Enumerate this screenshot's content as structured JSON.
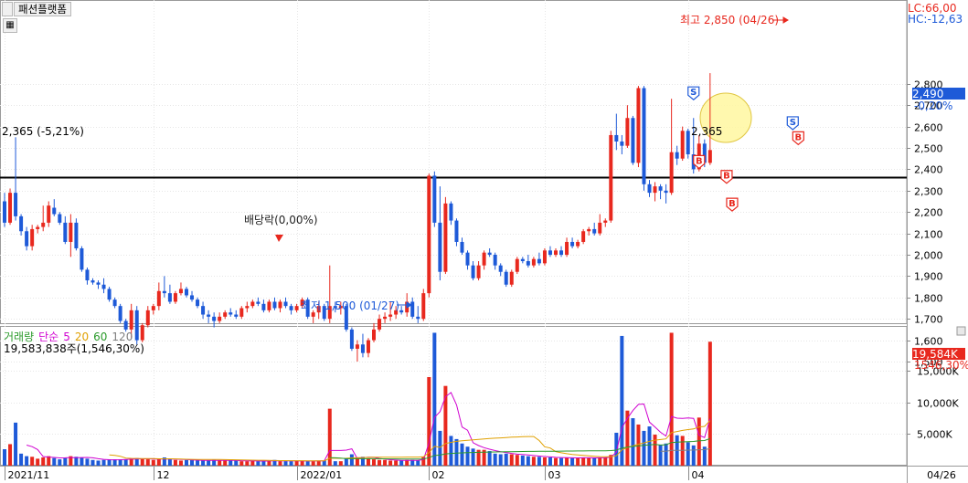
{
  "window": {
    "title": "패션플랫폼",
    "lc_label": "LC:66,00",
    "hc_label": "HC:-12,63"
  },
  "annotations": {
    "high": "최고 2,850 (04/26)",
    "low": "최저 1,500 (01/27)",
    "dividend": "배당락(0,00%)",
    "ref_line_label": "2,365 (-5,21%)",
    "ref_line_label2": "2,365",
    "current_price": "2,490",
    "current_change": "-0,20%",
    "buy_marker": "B",
    "sell_marker": "S"
  },
  "volume_legend": {
    "name": "거래량",
    "ma_type": "단순",
    "periods": [
      "5",
      "20",
      "60",
      "120"
    ],
    "period_colors": [
      "#d000d0",
      "#e0a000",
      "#2a9a2a",
      "#808080"
    ],
    "summary": "19,583,838주(1,546,30%)",
    "current_volume": "19,584K",
    "current_pct": "1546,30%"
  },
  "colors": {
    "up": "#e8281e",
    "down": "#1e5ad8",
    "ma5": "#d000d0",
    "ma20": "#e0a000",
    "ma60": "#2a9a2a",
    "ma120": "#808080"
  },
  "chart_data": [
    {
      "type": "candlestick",
      "title": "패션플랫폼",
      "y_ticks": [
        1500,
        1600,
        1700,
        1800,
        1900,
        2000,
        2100,
        2200,
        2300,
        2400,
        2500,
        2600,
        2700,
        2800
      ],
      "y_tick_labels": [
        "1,500",
        "1,600",
        "1,700",
        "1,800",
        "1,900",
        "2,000",
        "2,100",
        "2,200",
        "2,300",
        "2,400",
        "2,500",
        "2,600",
        "2,700",
        "2,800"
      ],
      "ylim": [
        1450,
        2900
      ],
      "x_tick_labels": [
        "2021/11",
        "12",
        "2022/01",
        "02",
        "03",
        "04",
        "04/26"
      ],
      "x_tick_index": [
        0,
        27,
        53,
        77,
        98,
        124,
        144
      ],
      "reference_line": 2365,
      "candles": [
        [
          2250,
          2290,
          2130,
          2150
        ],
        [
          2150,
          2310,
          2140,
          2290
        ],
        [
          2290,
          2550,
          2160,
          2180
        ],
        [
          2180,
          2190,
          2090,
          2110
        ],
        [
          2110,
          2130,
          2020,
          2040
        ],
        [
          2040,
          2140,
          2020,
          2120
        ],
        [
          2120,
          2140,
          2100,
          2130
        ],
        [
          2130,
          2230,
          2110,
          2150
        ],
        [
          2150,
          2250,
          2130,
          2230
        ],
        [
          2220,
          2260,
          2180,
          2190
        ],
        [
          2190,
          2200,
          2140,
          2150
        ],
        [
          2150,
          2180,
          2050,
          2060
        ],
        [
          2060,
          2190,
          1990,
          2150
        ],
        [
          2150,
          2170,
          2020,
          2030
        ],
        [
          2030,
          2040,
          1920,
          1930
        ],
        [
          1930,
          1940,
          1860,
          1880
        ],
        [
          1880,
          1890,
          1860,
          1870
        ],
        [
          1870,
          1880,
          1840,
          1860
        ],
        [
          1860,
          1890,
          1820,
          1840
        ],
        [
          1840,
          1850,
          1780,
          1790
        ],
        [
          1790,
          1800,
          1750,
          1760
        ],
        [
          1760,
          1770,
          1680,
          1690
        ],
        [
          1690,
          1700,
          1640,
          1650
        ],
        [
          1650,
          1770,
          1610,
          1740
        ],
        [
          1740,
          1760,
          1580,
          1600
        ],
        [
          1600,
          1680,
          1590,
          1670
        ],
        [
          1670,
          1760,
          1660,
          1740
        ],
        [
          1740,
          1770,
          1720,
          1760
        ],
        [
          1760,
          1870,
          1740,
          1830
        ],
        [
          1830,
          1900,
          1800,
          1820
        ],
        [
          1820,
          1860,
          1770,
          1780
        ],
        [
          1780,
          1830,
          1770,
          1820
        ],
        [
          1820,
          1870,
          1810,
          1840
        ],
        [
          1840,
          1850,
          1800,
          1810
        ],
        [
          1810,
          1830,
          1780,
          1790
        ],
        [
          1790,
          1800,
          1750,
          1760
        ],
        [
          1760,
          1780,
          1700,
          1720
        ],
        [
          1720,
          1740,
          1680,
          1710
        ],
        [
          1710,
          1730,
          1660,
          1690
        ],
        [
          1690,
          1730,
          1680,
          1710
        ],
        [
          1710,
          1740,
          1700,
          1730
        ],
        [
          1730,
          1750,
          1710,
          1720
        ],
        [
          1720,
          1740,
          1700,
          1710
        ],
        [
          1710,
          1760,
          1700,
          1750
        ],
        [
          1750,
          1780,
          1730,
          1760
        ],
        [
          1760,
          1790,
          1750,
          1780
        ],
        [
          1780,
          1800,
          1760,
          1770
        ],
        [
          1770,
          1790,
          1730,
          1740
        ],
        [
          1740,
          1790,
          1730,
          1780
        ],
        [
          1780,
          1800,
          1740,
          1750
        ],
        [
          1750,
          1790,
          1730,
          1780
        ],
        [
          1780,
          1800,
          1750,
          1760
        ],
        [
          1760,
          1770,
          1720,
          1740
        ],
        [
          1740,
          1770,
          1730,
          1760
        ],
        [
          1760,
          1800,
          1750,
          1790
        ],
        [
          1790,
          1800,
          1700,
          1710
        ],
        [
          1710,
          1740,
          1680,
          1730
        ],
        [
          1730,
          1780,
          1700,
          1760
        ],
        [
          1760,
          1770,
          1690,
          1700
        ],
        [
          1700,
          1950,
          1680,
          1760
        ],
        [
          1760,
          1780,
          1730,
          1750
        ],
        [
          1750,
          1780,
          1720,
          1760
        ],
        [
          1760,
          1770,
          1640,
          1650
        ],
        [
          1650,
          1660,
          1550,
          1560
        ],
        [
          1560,
          1600,
          1500,
          1580
        ],
        [
          1580,
          1630,
          1520,
          1540
        ],
        [
          1540,
          1610,
          1520,
          1600
        ],
        [
          1600,
          1680,
          1590,
          1650
        ],
        [
          1650,
          1720,
          1640,
          1700
        ],
        [
          1700,
          1730,
          1680,
          1710
        ],
        [
          1710,
          1780,
          1690,
          1720
        ],
        [
          1720,
          1760,
          1700,
          1740
        ],
        [
          1740,
          1760,
          1720,
          1730
        ],
        [
          1730,
          1820,
          1710,
          1780
        ],
        [
          1780,
          1800,
          1700,
          1710
        ],
        [
          1710,
          1760,
          1680,
          1700
        ],
        [
          1700,
          1840,
          1690,
          1820
        ],
        [
          1820,
          2380,
          1800,
          2370
        ],
        [
          2370,
          2390,
          2130,
          2150
        ],
        [
          2150,
          2320,
          1880,
          1920
        ],
        [
          1920,
          2270,
          1910,
          2240
        ],
        [
          2240,
          2250,
          2140,
          2160
        ],
        [
          2160,
          2170,
          2040,
          2060
        ],
        [
          2060,
          2080,
          2000,
          2010
        ],
        [
          2010,
          2020,
          1930,
          1950
        ],
        [
          1950,
          1970,
          1880,
          1890
        ],
        [
          1890,
          1970,
          1880,
          1950
        ],
        [
          1950,
          2020,
          1930,
          2010
        ],
        [
          2010,
          2030,
          1990,
          2000
        ],
        [
          2000,
          2010,
          1930,
          1950
        ],
        [
          1950,
          1960,
          1900,
          1920
        ],
        [
          1920,
          1930,
          1850,
          1860
        ],
        [
          1860,
          1930,
          1850,
          1920
        ],
        [
          1920,
          1990,
          1910,
          1980
        ],
        [
          1980,
          1990,
          1960,
          1970
        ],
        [
          1970,
          2000,
          1940,
          1950
        ],
        [
          1950,
          1990,
          1940,
          1980
        ],
        [
          1980,
          2010,
          1950,
          1960
        ],
        [
          1960,
          2030,
          1950,
          2020
        ],
        [
          2020,
          2040,
          1990,
          2000
        ],
        [
          2000,
          2030,
          1990,
          2020
        ],
        [
          2020,
          2040,
          1990,
          2000
        ],
        [
          2000,
          2080,
          1990,
          2060
        ],
        [
          2060,
          2080,
          2030,
          2040
        ],
        [
          2040,
          2070,
          2030,
          2060
        ],
        [
          2060,
          2120,
          2050,
          2110
        ],
        [
          2110,
          2130,
          2090,
          2120
        ],
        [
          2120,
          2150,
          2090,
          2100
        ],
        [
          2100,
          2190,
          2090,
          2150
        ],
        [
          2150,
          2170,
          2130,
          2160
        ],
        [
          2160,
          2580,
          2150,
          2560
        ],
        [
          2560,
          2660,
          2490,
          2530
        ],
        [
          2530,
          2560,
          2470,
          2510
        ],
        [
          2510,
          2700,
          2500,
          2640
        ],
        [
          2640,
          2650,
          2420,
          2430
        ],
        [
          2430,
          2790,
          2410,
          2780
        ],
        [
          2780,
          2790,
          2300,
          2330
        ],
        [
          2330,
          2350,
          2270,
          2290
        ],
        [
          2290,
          2340,
          2250,
          2320
        ],
        [
          2320,
          2330,
          2260,
          2300
        ],
        [
          2300,
          2330,
          2240,
          2290
        ],
        [
          2290,
          2730,
          2280,
          2480
        ],
        [
          2480,
          2510,
          2420,
          2450
        ],
        [
          2450,
          2600,
          2440,
          2580
        ],
        [
          2580,
          2590,
          2450,
          2470
        ],
        [
          2470,
          2640,
          2380,
          2400
        ],
        [
          2400,
          2560,
          2390,
          2520
        ],
        [
          2520,
          2540,
          2410,
          2430
        ],
        [
          2430,
          2850,
          2420,
          2490
        ]
      ]
    },
    {
      "type": "bar",
      "title": "거래량",
      "y_ticks": [
        5000,
        10000,
        15000,
        19584
      ],
      "y_tick_labels": [
        "5,000K",
        "10,000K",
        "15,000K",
        "19,584K"
      ],
      "ylim": [
        0,
        21500
      ],
      "volumes": [
        2600,
        3400,
        6800,
        1900,
        1500,
        1400,
        1100,
        1300,
        1500,
        1200,
        1000,
        1200,
        1500,
        1400,
        1300,
        1100,
        900,
        800,
        900,
        1000,
        1000,
        1000,
        1000,
        1100,
        1200,
        1100,
        1000,
        900,
        1000,
        1300,
        1000,
        900,
        800,
        900,
        900,
        800,
        800,
        800,
        900,
        800,
        800,
        800,
        800,
        700,
        700,
        800,
        700,
        700,
        800,
        900,
        700,
        700,
        700,
        800,
        800,
        700,
        700,
        800,
        800,
        9000,
        700,
        700,
        1100,
        1800,
        1300,
        1400,
        1100,
        1000,
        900,
        900,
        800,
        800,
        800,
        900,
        900,
        800,
        1400,
        14000,
        21000,
        5500,
        12600,
        4700,
        4200,
        3500,
        3000,
        2700,
        2500,
        2500,
        2300,
        1900,
        1800,
        1900,
        1800,
        1700,
        1600,
        1500,
        1400,
        1400,
        1300,
        1300,
        1200,
        1200,
        1300,
        1200,
        1200,
        1300,
        1200,
        1200,
        1300,
        1300,
        1700,
        5200,
        20500,
        8700,
        7500,
        6500,
        5500,
        6200,
        4900,
        3300,
        3500,
        21000,
        4800,
        4700,
        3700,
        3200,
        7600,
        3000,
        19584
      ]
    }
  ]
}
